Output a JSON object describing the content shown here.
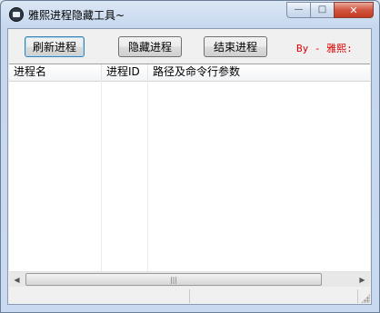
{
  "window": {
    "title": "雅熙进程隐藏工具~",
    "icon": "app-icon"
  },
  "title_buttons": {
    "minimize": "—",
    "maximize": "□",
    "close": "✕"
  },
  "toolbar": {
    "refresh_label": "刷新进程",
    "hide_label": "隐藏进程",
    "end_label": "结束进程",
    "credit": "By - 雅熙:",
    "credit_color": "#e00000"
  },
  "process_list": {
    "columns": [
      "进程名",
      "进程ID",
      "路径及命令行参数"
    ],
    "rows": []
  },
  "scrollbar": {
    "left_arrow": "◀",
    "right_arrow": "▶",
    "grip": "|||"
  },
  "status_bar": {
    "panels": [
      "",
      ""
    ]
  }
}
